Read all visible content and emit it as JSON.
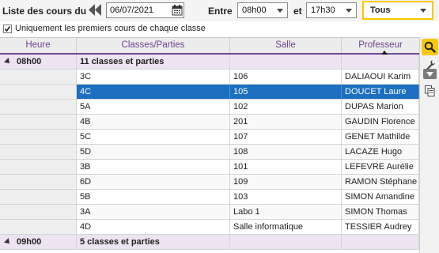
{
  "toolbar": {
    "title_label": "Liste des cours du",
    "date_value": "06/07/2021",
    "entre_label": "Entre",
    "start_time": "08h00",
    "et_label": "et",
    "end_time": "17h30",
    "filter_value": "Tous"
  },
  "options": {
    "first_courses_label": "Uniquement les premiers cours de chaque classe",
    "first_courses_checked": true
  },
  "grid": {
    "columns": {
      "heure": "Heure",
      "classe": "Classes/Parties",
      "salle": "Salle",
      "prof": "Professeur"
    },
    "groups": [
      {
        "time": "08h00",
        "label": "11 classes et parties",
        "rows": [
          {
            "classe": "3C",
            "salle": "106",
            "prof": "DALIAOUI Karim"
          },
          {
            "classe": "4C",
            "salle": "105",
            "prof": "DOUCET Laure",
            "selected": true
          },
          {
            "classe": "5A",
            "salle": "102",
            "prof": "DUPAS Marion"
          },
          {
            "classe": "4B",
            "salle": "201",
            "prof": "GAUDIN Florence"
          },
          {
            "classe": "5C",
            "salle": "107",
            "prof": "GENET Mathilde"
          },
          {
            "classe": "5D",
            "salle": "108",
            "prof": "LACAZE Hugo"
          },
          {
            "classe": "3B",
            "salle": "101",
            "prof": "LEFEVRE Aurélie"
          },
          {
            "classe": "6D",
            "salle": "109",
            "prof": "RAMON Stéphane"
          },
          {
            "classe": "5B",
            "salle": "103",
            "prof": "SIMON Amandine"
          },
          {
            "classe": "3A",
            "salle": "Labo 1",
            "prof": "SIMON Thomas"
          },
          {
            "classe": "4D",
            "salle": "Salle informatique",
            "prof": "TESSIER Audrey"
          }
        ]
      },
      {
        "time": "09h00",
        "label": "5 classes et parties",
        "rows": []
      }
    ]
  },
  "colors": {
    "accent_purple": "#6a4592",
    "group_row_bg": "#ece4f1",
    "selection_blue": "#1c6fc0",
    "highlight_yellow": "#f9c800"
  },
  "icons": {
    "prev": "double-chevron-left-icon",
    "calendar": "calendar-icon",
    "search": "search-icon",
    "wrench": "wrench-icon",
    "filter": "dropdown-menu-icon",
    "copy": "copy-icon"
  }
}
